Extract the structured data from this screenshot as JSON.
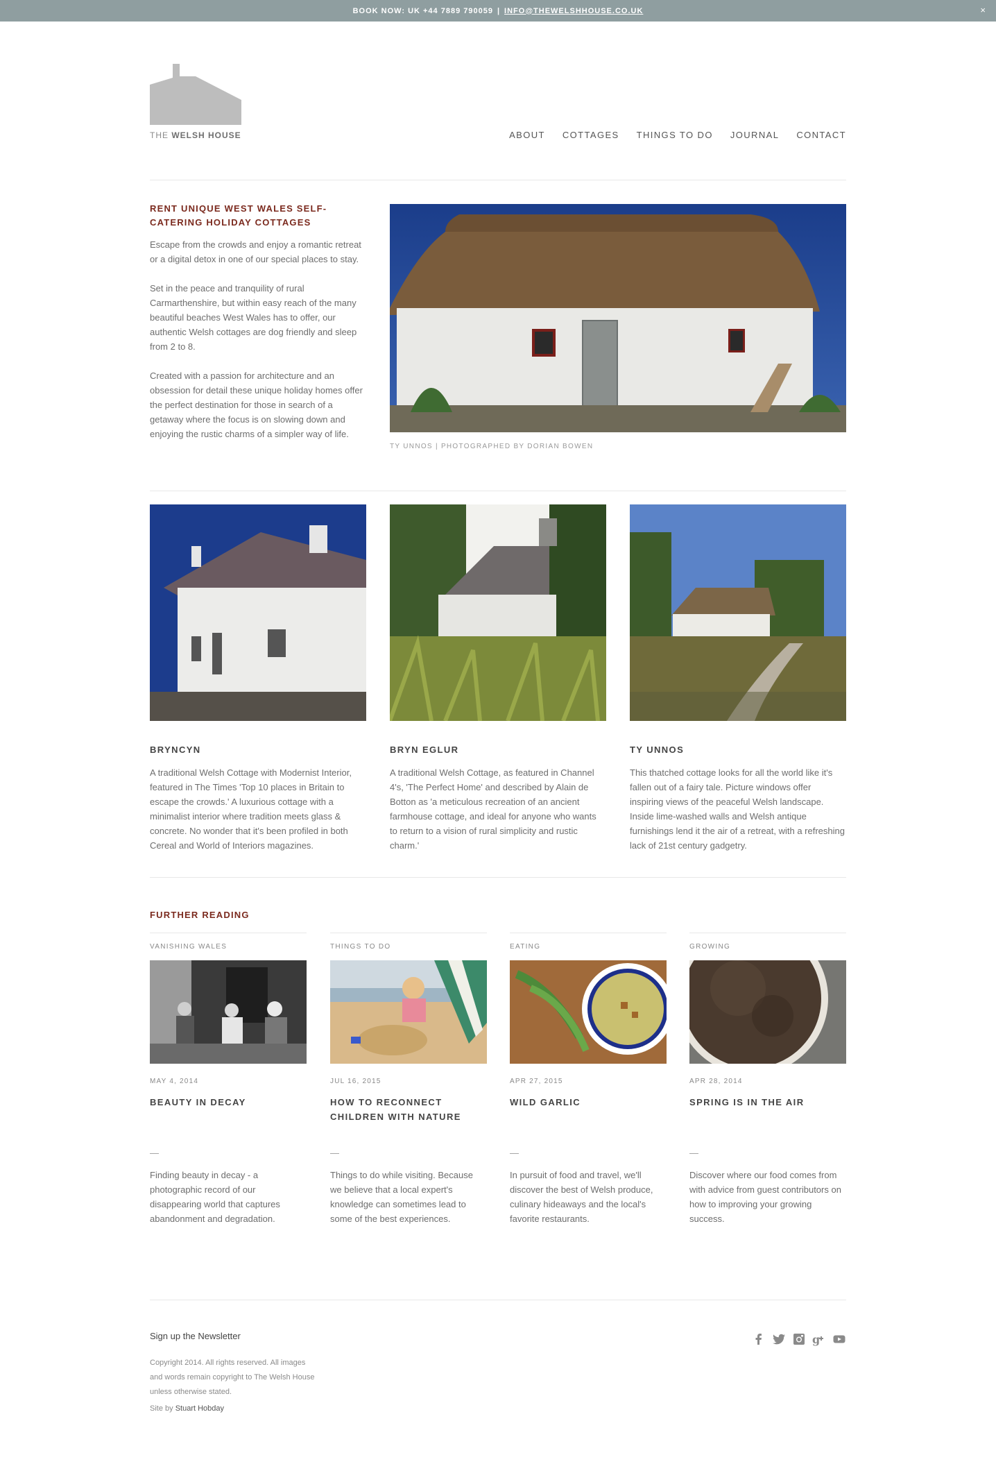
{
  "topbar": {
    "book_text": "BOOK NOW: UK +44 7889 790059",
    "separator": "|",
    "email": "INFO@THEWELSHHOUSE.CO.UK",
    "close_glyph": "×"
  },
  "brand": {
    "name_light": "THE",
    "name_bold": "WELSH HOUSE",
    "logo_color": "#bdbdbd"
  },
  "nav": {
    "items": [
      "ABOUT",
      "COTTAGES",
      "THINGS TO DO",
      "JOURNAL",
      "CONTACT"
    ]
  },
  "intro": {
    "headline": "RENT UNIQUE WEST WALES SELF-CATERING HOLIDAY COTTAGES",
    "paragraphs": [
      "Escape from the crowds and enjoy a romantic retreat or a digital detox in one of our special places to stay.",
      "Set in the peace and tranquility of rural Carmarthenshire, but within easy reach of the many beautiful beaches West Wales has to offer, our authentic Welsh cottages are dog friendly and sleep from 2 to 8.",
      "Created with a passion for architecture and an obsession for detail these unique holiday homes offer the perfect destination for those in search of a getaway where the focus is on slowing down and enjoying the rustic charms of a simpler way of life."
    ],
    "hero_caption": "TY UNNOS | PHOTOGRAPHED BY DORIAN BOWEN"
  },
  "cottages": [
    {
      "name": "BRYNCYN",
      "description": "A traditional Welsh Cottage with Modernist Interior, featured in The Times 'Top 10 places in Britain to escape the crowds.' A luxurious cottage with a minimalist interior where tradition meets glass & concrete. No wonder that it's been profiled in both Cereal and World of Interiors magazines."
    },
    {
      "name": "BRYN EGLUR",
      "description": "A traditional Welsh Cottage, as featured in Channel 4's, 'The Perfect Home' and described by Alain de Botton as 'a meticulous recreation of an ancient farmhouse cottage, and ideal for anyone who wants to return to a vision of rural simplicity and rustic charm.'"
    },
    {
      "name": "TY UNNOS",
      "description": "This thatched cottage looks for all the world like it's fallen out of a fairy tale. Picture windows offer inspiring views of the peaceful Welsh landscape. Inside lime-washed walls and Welsh antique furnishings lend it the air of a retreat, with a refreshing lack of 21st century gadgetry."
    }
  ],
  "further_reading": {
    "title": "FURTHER READING",
    "posts": [
      {
        "category": "VANISHING WALES",
        "date": "MAY 4, 2014",
        "title": "BEAUTY IN DECAY",
        "dash": "—",
        "excerpt": "Finding beauty in decay - a photographic record of our disappearing world that captures abandonment and degradation."
      },
      {
        "category": "THINGS TO DO",
        "date": "JUL 16, 2015",
        "title": "HOW TO RECONNECT CHILDREN WITH NATURE",
        "dash": "—",
        "excerpt": "Things to do while visiting. Because we believe that a local expert's knowledge can sometimes lead to some of the best experiences."
      },
      {
        "category": "EATING",
        "date": "APR 27, 2015",
        "title": "WILD GARLIC",
        "dash": "—",
        "excerpt": "In pursuit of food and travel, we'll discover the best of Welsh produce, culinary hideaways and the local's favorite restaurants."
      },
      {
        "category": "GROWING",
        "date": "APR 28, 2014",
        "title": "SPRING IS IN THE AIR",
        "dash": "—",
        "excerpt": "Discover where our food comes from with advice from guest contributors on how to improving your growing success."
      }
    ]
  },
  "footer": {
    "newsletter": "Sign up the Newsletter",
    "copyright": "Copyright 2014. All rights reserved. All images and words remain copyright to The Welsh House unless otherwise stated.",
    "credit_prefix": "Site by",
    "credit_name": "Stuart Hobday",
    "social": [
      "facebook-icon",
      "twitter-icon",
      "instagram-icon",
      "google-plus-icon",
      "youtube-icon"
    ]
  },
  "colors": {
    "topbar_bg": "#8f9ea0",
    "accent": "#7b2a1e",
    "rule": "#e8e8e8"
  }
}
